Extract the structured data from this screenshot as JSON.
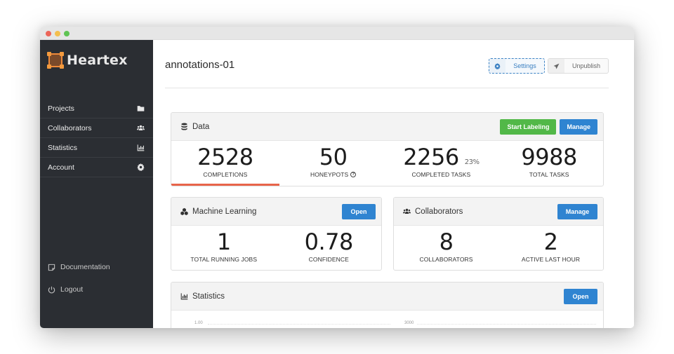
{
  "window": {
    "controls": [
      "close",
      "minimize",
      "maximize"
    ]
  },
  "sidebar": {
    "logo_text": "Heartex",
    "items": [
      {
        "label": "Projects",
        "icon": "folder-icon"
      },
      {
        "label": "Collaborators",
        "icon": "users-icon"
      },
      {
        "label": "Statistics",
        "icon": "chart-icon"
      },
      {
        "label": "Account",
        "icon": "gear-icon"
      }
    ],
    "bottom_links": [
      {
        "label": "Documentation",
        "icon": "document-icon"
      },
      {
        "label": "Logout",
        "icon": "power-icon"
      }
    ]
  },
  "header": {
    "title": "annotations-01",
    "settings_label": "Settings",
    "unpublish_label": "Unpublish"
  },
  "data_card": {
    "title": "Data",
    "start_labeling_label": "Start Labeling",
    "manage_label": "Manage",
    "stats": [
      {
        "value": "2528",
        "label": "COMPLETIONS",
        "active": true
      },
      {
        "value": "50",
        "label": "HONEYPOTS",
        "help": "?"
      },
      {
        "value": "2256",
        "label": "COMPLETED TASKS",
        "percent": "23%"
      },
      {
        "value": "9988",
        "label": "TOTAL TASKS"
      }
    ],
    "accent_color": "#e8644a"
  },
  "ml_card": {
    "title": "Machine Learning",
    "open_label": "Open",
    "stats": [
      {
        "value": "1",
        "label": "TOTAL RUNNING JOBS"
      },
      {
        "value": "0.78",
        "label": "CONFIDENCE"
      }
    ]
  },
  "collab_card": {
    "title": "Collaborators",
    "manage_label": "Manage",
    "stats": [
      {
        "value": "8",
        "label": "COLLABORATORS"
      },
      {
        "value": "2",
        "label": "ACTIVE LAST HOUR"
      }
    ]
  },
  "stats_card": {
    "title": "Statistics",
    "open_label": "Open",
    "chart_ticks": [
      "1.00",
      "3000"
    ]
  },
  "colors": {
    "sidebar_bg": "#2b2e33",
    "primary_blue": "#2f84d1",
    "success_green": "#52b848"
  }
}
